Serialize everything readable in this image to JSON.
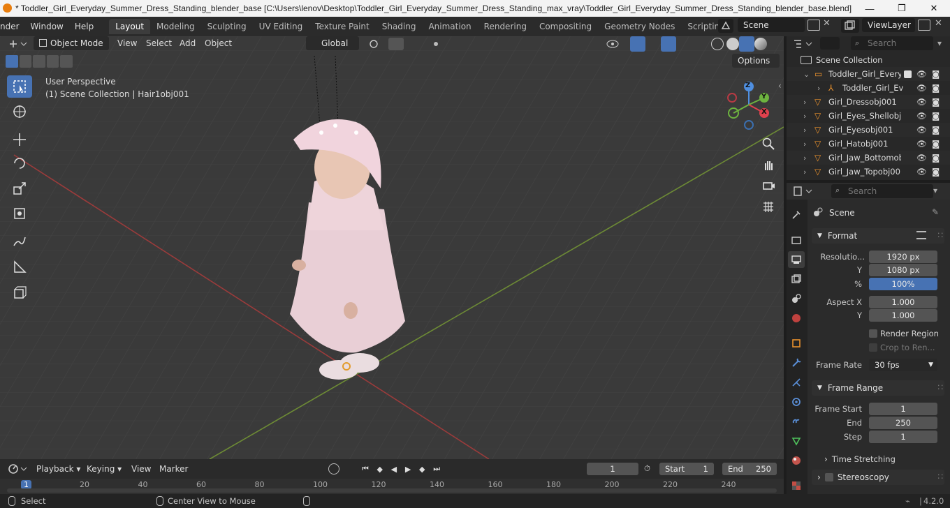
{
  "window": {
    "title": "* Toddler_Girl_Everyday_Summer_Dress_Standing_blender_base [C:\\Users\\lenov\\Desktop\\Toddler_Girl_Everyday_Summer_Dress_Standing_max_vray\\Toddler_Girl_Everyday_Summer_Dress_Standing_blender_base.blend] - Blende...",
    "minimize": "—",
    "restore": "❐",
    "close": "✕"
  },
  "menus": [
    "nder",
    "Window",
    "Help"
  ],
  "workspaces": [
    "Layout",
    "Modeling",
    "Sculpting",
    "UV Editing",
    "Texture Paint",
    "Shading",
    "Animation",
    "Rendering",
    "Compositing",
    "Geometry Nodes",
    "Scripting"
  ],
  "scene_name": "Scene",
  "view_layer": "ViewLayer",
  "viewport_header": {
    "mode": "Object Mode",
    "menus": [
      "View",
      "Select",
      "Add",
      "Object"
    ],
    "transform_orientation": "Global",
    "options_label": "Options"
  },
  "viewport_overlay": {
    "perspective": "User Perspective",
    "collection_info": "(1) Scene Collection | Hair1obj001"
  },
  "gizmo": {
    "z": "Z",
    "y": "Y",
    "x": "X"
  },
  "outliner": {
    "search_placeholder": "Search",
    "root": "Scene Collection",
    "items": [
      {
        "name": "Toddler_Girl_Everyd",
        "type": "collection",
        "level": 1
      },
      {
        "name": "Toddler_Girl_Ev",
        "type": "armature",
        "level": 2
      },
      {
        "name": "Girl_Dressobj001",
        "type": "mesh",
        "level": 1
      },
      {
        "name": "Girl_Eyes_Shellobj(",
        "type": "mesh",
        "level": 1
      },
      {
        "name": "Girl_Eyesobj001",
        "type": "mesh",
        "level": 1
      },
      {
        "name": "Girl_Hatobj001",
        "type": "mesh",
        "level": 1
      },
      {
        "name": "Girl_Jaw_Bottomob",
        "type": "mesh",
        "level": 1
      },
      {
        "name": "Girl_Jaw_Topobj00",
        "type": "mesh",
        "level": 1
      }
    ]
  },
  "properties": {
    "search_placeholder": "Search",
    "context": "Scene",
    "format": {
      "title": "Format",
      "resolution_label": "Resolutio...",
      "res_x": "1920 px",
      "y_label": "Y",
      "res_y": "1080 px",
      "percent_label": "%",
      "percent": "100%",
      "aspect_label": "Aspect X",
      "aspect_x": "1.000",
      "aspect_y": "1.000",
      "render_region": "Render Region",
      "crop": "Crop to Ren...",
      "frame_rate_label": "Frame Rate",
      "frame_rate": "30 fps"
    },
    "frame_range": {
      "title": "Frame Range",
      "start_label": "Frame Start",
      "start": "1",
      "end_label": "End",
      "end": "250",
      "step_label": "Step",
      "step": "1"
    },
    "time_stretching": "Time Stretching",
    "stereoscopy": "Stereoscopy"
  },
  "timeline": {
    "menus": [
      "Playback",
      "Keying",
      "View",
      "Marker"
    ],
    "current_frame": "1",
    "start_label": "Start",
    "start": "1",
    "end_label": "End",
    "end": "250",
    "ticks": [
      "1",
      "20",
      "40",
      "60",
      "80",
      "100",
      "120",
      "140",
      "160",
      "180",
      "200",
      "220",
      "240"
    ]
  },
  "status": {
    "select": "Select",
    "center": "Center View to Mouse",
    "version": "4.2.0"
  }
}
